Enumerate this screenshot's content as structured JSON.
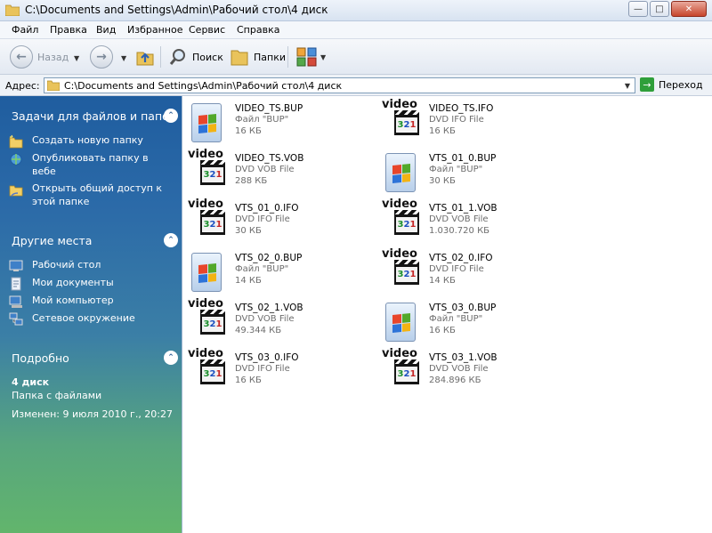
{
  "window": {
    "title": "C:\\Documents and Settings\\Admin\\Рабочий стол\\4 диск",
    "min_glyph": "—",
    "max_glyph": "□",
    "close_glyph": "✕"
  },
  "menu": [
    "Файл",
    "Правка",
    "Вид",
    "Избранное",
    "Сервис",
    "Справка"
  ],
  "toolbar": {
    "back_label": "Назад",
    "search_label": "Поиск",
    "folders_label": "Папки"
  },
  "address": {
    "label": "Адрес:",
    "value": "C:\\Documents and Settings\\Admin\\Рабочий стол\\4 диск",
    "go_label": "Переход"
  },
  "tasks": {
    "header": "Задачи для файлов и папок",
    "items": [
      "Создать новую папку",
      "Опубликовать папку в вебе",
      "Открыть общий доступ к этой папке"
    ]
  },
  "places": {
    "header": "Другие места",
    "items": [
      "Рабочий стол",
      "Мои документы",
      "Мой компьютер",
      "Сетевое окружение"
    ]
  },
  "details": {
    "header": "Подробно",
    "name": "4 диск",
    "type": "Папка с файлами",
    "modified": "Изменен: 9 июля 2010 г., 20:27"
  },
  "files": [
    {
      "name": "VIDEO_TS.BUP",
      "type": "Файл \"BUP\"",
      "size": "16 КБ",
      "icon": "bup-file-icon"
    },
    {
      "name": "VIDEO_TS.IFO",
      "type": "DVD IFO File",
      "size": "16 КБ",
      "icon": "video-clapper-icon"
    },
    {
      "name": "VIDEO_TS.VOB",
      "type": "DVD VOB File",
      "size": "288 КБ",
      "icon": "video-clapper-icon"
    },
    {
      "name": "VTS_01_0.BUP",
      "type": "Файл \"BUP\"",
      "size": "30 КБ",
      "icon": "bup-file-icon"
    },
    {
      "name": "VTS_01_0.IFO",
      "type": "DVD IFO File",
      "size": "30 КБ",
      "icon": "video-clapper-icon"
    },
    {
      "name": "VTS_01_1.VOB",
      "type": "DVD VOB File",
      "size": "1.030.720 КБ",
      "icon": "video-clapper-icon"
    },
    {
      "name": "VTS_02_0.BUP",
      "type": "Файл \"BUP\"",
      "size": "14 КБ",
      "icon": "bup-file-icon"
    },
    {
      "name": "VTS_02_0.IFO",
      "type": "DVD IFO File",
      "size": "14 КБ",
      "icon": "video-clapper-icon"
    },
    {
      "name": "VTS_02_1.VOB",
      "type": "DVD VOB File",
      "size": "49.344 КБ",
      "icon": "video-clapper-icon"
    },
    {
      "name": "VTS_03_0.BUP",
      "type": "Файл \"BUP\"",
      "size": "16 КБ",
      "icon": "bup-file-icon"
    },
    {
      "name": "VTS_03_0.IFO",
      "type": "DVD IFO File",
      "size": "16 КБ",
      "icon": "video-clapper-icon"
    },
    {
      "name": "VTS_03_1.VOB",
      "type": "DVD VOB File",
      "size": "284.896 КБ",
      "icon": "video-clapper-icon"
    }
  ],
  "icon_text": {
    "video_label": "video",
    "clapper_digits": [
      "3",
      "2",
      "1"
    ]
  },
  "colors": {
    "pane_top": "#1f5d9f",
    "pane_bottom": "#62b56c",
    "close_red": "#c7452b",
    "go_green": "#2f9f3a"
  }
}
